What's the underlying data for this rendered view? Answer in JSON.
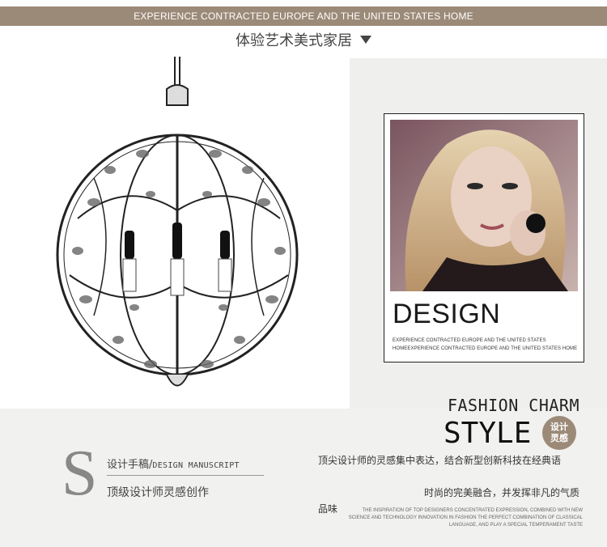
{
  "header": {
    "banner": "EXPERIENCE CONTRACTED EUROPE AND THE UNITED STATES HOME",
    "subtitle": "体验艺术美式家居"
  },
  "card": {
    "title": "DESIGN",
    "description": "EXPERIENCE CONTRACTED EUROPE AND THE UNITED STATES HOMEEXPERIENCE CONTRACTED EUROPE AND THE UNITED STATES HOME"
  },
  "style_block": {
    "fashion": "FASHION CHARM",
    "style": "STYLE",
    "badge_line1": "设计",
    "badge_line2": "灵感"
  },
  "manuscript": {
    "letter": "S",
    "label_cn": "设计手稿/",
    "label_en": "DESIGN MANUSCRIPT",
    "sub": "顶级设计师灵感创作"
  },
  "description": {
    "cn_line1": "顶尖设计师的灵感集中表达，结合新型创新科技在经典语",
    "cn_line2": "时尚的完美融合，并发挥非凡的气质",
    "cn_tail": "品味",
    "en": "THE INSPIRATION OF TOP DESIGNERS CONCENTRATED EXPRESSION, COMBINED WITH NEW SCIENCE AND TECHNOLOGY INNOVATION IN FASHION THE PERFECT COMBINATION OF CLASSICAL LANGUAGE, AND PLAY A SPECIAL TEMPERAMENT TASTE"
  },
  "colors": {
    "accent": "#9c8a78",
    "panel": "#efefed"
  }
}
